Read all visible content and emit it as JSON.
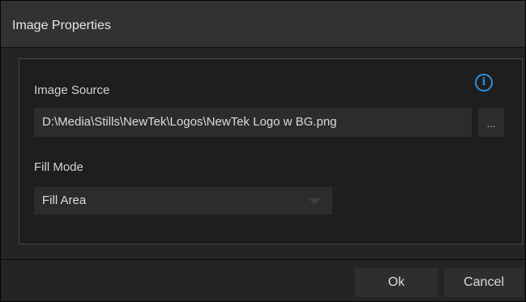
{
  "dialog": {
    "title": "Image Properties"
  },
  "panel": {
    "info_icon": "info-icon",
    "info_glyph": "i",
    "image_source_label": "Image Source",
    "image_source_value": "D:\\Media\\Stills\\NewTek\\Logos\\NewTek Logo w BG.png",
    "browse_label": "...",
    "fill_mode_label": "Fill Mode",
    "fill_mode_value": "Fill Area"
  },
  "footer": {
    "ok_label": "Ok",
    "cancel_label": "Cancel"
  },
  "colors": {
    "accent": "#2f8ed6",
    "background": "#242424",
    "titlebar": "#323232",
    "field": "#2c2c2c"
  }
}
